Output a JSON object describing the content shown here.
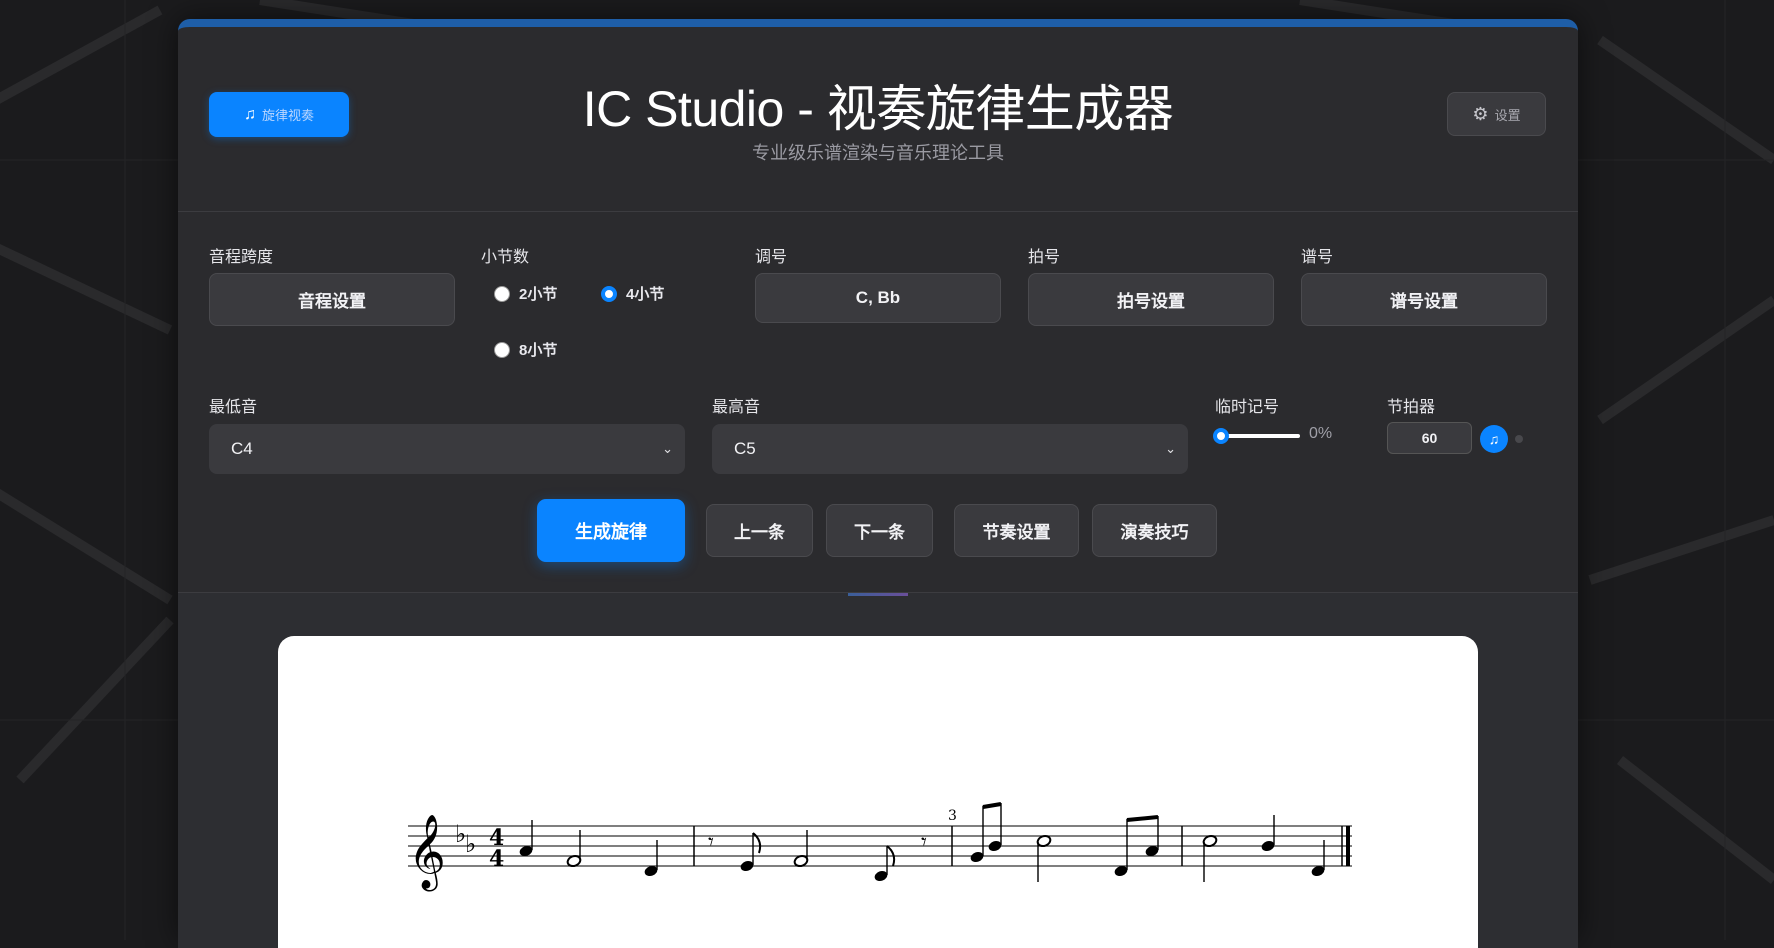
{
  "header": {
    "mode_button": {
      "label": "旋律视奏",
      "icon": "music-note-icon"
    },
    "title": "IC Studio - 视奏旋律生成器",
    "subtitle": "专业级乐谱渲染与音乐理论工具",
    "settings_button": {
      "label": "设置",
      "icon": "gear-icon"
    }
  },
  "controls": {
    "interval_span": {
      "label": "音程跨度",
      "button": "音程设置"
    },
    "measures": {
      "label": "小节数",
      "options": [
        {
          "label": "2小节",
          "checked": false
        },
        {
          "label": "4小节",
          "checked": true
        },
        {
          "label": "8小节",
          "checked": false
        }
      ]
    },
    "key_signature": {
      "label": "调号",
      "value": "C, Bb"
    },
    "time_signature": {
      "label": "拍号",
      "button": "拍号设置"
    },
    "clef": {
      "label": "谱号",
      "button": "谱号设置"
    },
    "lowest_note": {
      "label": "最低音",
      "value": "C4"
    },
    "highest_note": {
      "label": "最高音",
      "value": "C5"
    },
    "accidentals": {
      "label": "临时记号",
      "value": "0%",
      "fraction": 0
    },
    "metronome": {
      "label": "节拍器",
      "bpm": "60",
      "icon": "music-note-icon"
    }
  },
  "actions": {
    "generate": "生成旋律",
    "previous": "上一条",
    "next": "下一条",
    "rhythm_settings": "节奏设置",
    "techniques": "演奏技巧"
  },
  "score": {
    "clef": "treble",
    "key_signature_flats": [
      "Bb",
      "Eb"
    ],
    "time_signature": "4/4",
    "tuplet_label": "3",
    "measures": [
      [
        "A4 quarter",
        "F4 half",
        "C4 quarter"
      ],
      [
        "eighth rest",
        "D4 eighth",
        "F4 half",
        "C4 eighth",
        "eighth rest"
      ],
      [
        "D4 eighth triplet",
        "G4 eighth triplet",
        "Bb4 half triplet",
        "C4 eighth",
        "E4 eighth"
      ],
      [
        "Bb4 half",
        "G4 quarter",
        "C4 quarter"
      ]
    ]
  },
  "colors": {
    "accent": "#0a84ff",
    "panel": "#2b2b2e",
    "background": "#1b1b1d",
    "top_bar": "#1e5ea8"
  }
}
